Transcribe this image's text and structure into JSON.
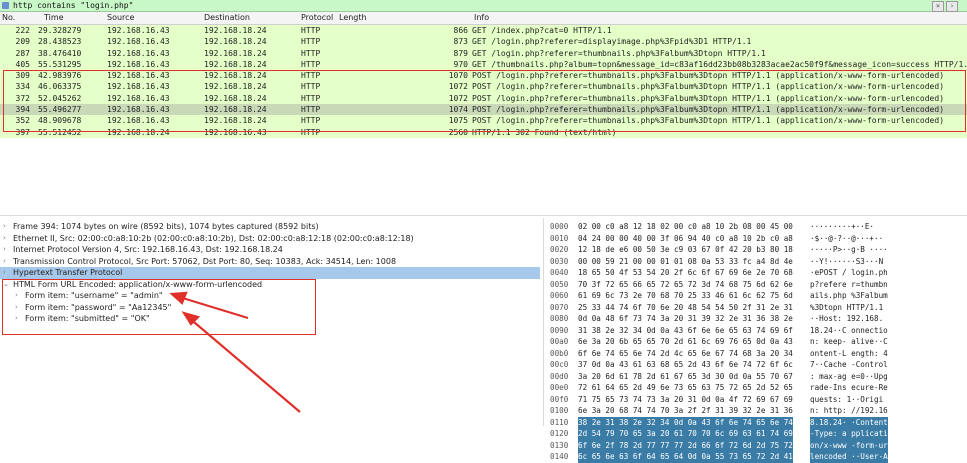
{
  "filter": {
    "value": "http contains \"login.php\""
  },
  "columns": {
    "no": "No.",
    "time": "Time",
    "source": "Source",
    "destination": "Destination",
    "protocol": "Protocol",
    "length": "Length",
    "info": "Info"
  },
  "packets": [
    {
      "no": "222",
      "time": "29.328279",
      "src": "192.168.16.43",
      "dst": "192.168.18.24",
      "proto": "HTTP",
      "len": "866",
      "info": "GET /index.php?cat=0 HTTP/1.1",
      "bg": "#e4ffc7"
    },
    {
      "no": "209",
      "time": "28.438523",
      "src": "192.168.16.43",
      "dst": "192.168.18.24",
      "proto": "HTTP",
      "len": "873",
      "info": "GET /login.php?referer=displayimage.php%3Fpid%3D1 HTTP/1.1",
      "bg": "#e4ffc7"
    },
    {
      "no": "287",
      "time": "38.476410",
      "src": "192.168.16.43",
      "dst": "192.168.18.24",
      "proto": "HTTP",
      "len": "879",
      "info": "GET /login.php?referer=thumbnails.php%3Falbum%3Dtopn HTTP/1.1",
      "bg": "#e4ffc7"
    },
    {
      "no": "405",
      "time": "55.531295",
      "src": "192.168.16.43",
      "dst": "192.168.18.24",
      "proto": "HTTP",
      "len": "970",
      "info": "GET /thumbnails.php?album=topn&message_id=c83af16dd23bb08b3283acae2ac50f9f&message_icon=success HTTP/1.1",
      "bg": "#e4ffc7"
    },
    {
      "no": "309",
      "time": "42.983976",
      "src": "192.168.16.43",
      "dst": "192.168.18.24",
      "proto": "HTTP",
      "len": "1070",
      "info": "POST /login.php?referer=thumbnails.php%3Falbum%3Dtopn HTTP/1.1  (application/x-www-form-urlencoded)",
      "bg": "#e4ffc7"
    },
    {
      "no": "334",
      "time": "46.063375",
      "src": "192.168.16.43",
      "dst": "192.168.18.24",
      "proto": "HTTP",
      "len": "1072",
      "info": "POST /login.php?referer=thumbnails.php%3Falbum%3Dtopn HTTP/1.1  (application/x-www-form-urlencoded)",
      "bg": "#e4ffc7"
    },
    {
      "no": "372",
      "time": "52.045262",
      "src": "192.168.16.43",
      "dst": "192.168.18.24",
      "proto": "HTTP",
      "len": "1072",
      "info": "POST /login.php?referer=thumbnails.php%3Falbum%3Dtopn HTTP/1.1  (application/x-www-form-urlencoded)",
      "bg": "#e4ffc7"
    },
    {
      "no": "394",
      "time": "55.496277",
      "src": "192.168.16.43",
      "dst": "192.168.18.24",
      "proto": "HTTP",
      "len": "1074",
      "info": "POST /login.php?referer=thumbnails.php%3Falbum%3Dtopn HTTP/1.1  (application/x-www-form-urlencoded)",
      "bg": "#c9d9b8"
    },
    {
      "no": "352",
      "time": "48.909678",
      "src": "192.168.16.43",
      "dst": "192.168.18.24",
      "proto": "HTTP",
      "len": "1075",
      "info": "POST /login.php?referer=thumbnails.php%3Falbum%3Dtopn HTTP/1.1  (application/x-www-form-urlencoded)",
      "bg": "#e4ffc7"
    },
    {
      "no": "397",
      "time": "55.512452",
      "src": "192.168.18.24",
      "dst": "192.168.16.43",
      "proto": "HTTP",
      "len": "2560",
      "info": "HTTP/1.1 302 Found  (text/html)",
      "bg": "#e4ffc7"
    }
  ],
  "details": [
    {
      "text": "Frame 394: 1074 bytes on wire (8592 bits), 1074 bytes captured (8592 bits)",
      "arrow": "›",
      "sub": false,
      "sel": false
    },
    {
      "text": "Ethernet II, Src: 02:00:c0:a8:10:2b (02:00:c0:a8:10:2b), Dst: 02:00:c0:a8:12:18 (02:00:c0:a8:12:18)",
      "arrow": "›",
      "sub": false,
      "sel": false
    },
    {
      "text": "Internet Protocol Version 4, Src: 192.168.16.43, Dst: 192.168.18.24",
      "arrow": "›",
      "sub": false,
      "sel": false
    },
    {
      "text": "Transmission Control Protocol, Src Port: 57062, Dst Port: 80, Seq: 10383, Ack: 34514, Len: 1008",
      "arrow": "›",
      "sub": false,
      "sel": false
    },
    {
      "text": "Hypertext Transfer Protocol",
      "arrow": "›",
      "sub": false,
      "sel": true
    },
    {
      "text": "HTML Form URL Encoded: application/x-www-form-urlencoded",
      "arrow": "⌄",
      "sub": false,
      "sel": false
    },
    {
      "text": "Form item: \"username\" = \"admin\"",
      "arrow": "›",
      "sub": true,
      "sel": false
    },
    {
      "text": "Form item: \"password\" = \"Aa12345\"",
      "arrow": "›",
      "sub": true,
      "sel": false
    },
    {
      "text": "Form item: \"submitted\" = \"OK\"",
      "arrow": "›",
      "sub": true,
      "sel": false
    }
  ],
  "hexdump": [
    {
      "off": "0000",
      "bytes": "02 00 c0 a8 12 18 02 00  c0 a8 10 2b 08 00 45 00",
      "asc": "·········+··E·"
    },
    {
      "off": "0010",
      "bytes": "04 24 00 00 40 00 3f 06  94 40 c0 a8 10 2b c0 a8",
      "asc": "·$··@·?··@···+··"
    },
    {
      "off": "0020",
      "bytes": "12 18 de e6 00 50 3e c9  03 67 0f 42 20 b3 80 18",
      "asc": "·····P>··g·B ····"
    },
    {
      "off": "0030",
      "bytes": "00 00 59 21 00 00 01 01  08 0a 53 33 fc a4 8d 4e",
      "asc": "··Y!······S3···N"
    },
    {
      "off": "0040",
      "bytes": "18 65 50 4f 53 54 20 2f  6c 6f 67 69 6e 2e 70 68",
      "asc": "·ePOST / login.ph"
    },
    {
      "off": "0050",
      "bytes": "70 3f 72 65 66 65 72 65  72 3d 74 68 75 6d 62 6e",
      "asc": "p?refere r=thumbn"
    },
    {
      "off": "0060",
      "bytes": "61 69 6c 73 2e 70 68 70  25 33 46 61 6c 62 75 6d",
      "asc": "ails.php %3Falbum"
    },
    {
      "off": "0070",
      "bytes": "25 33 44 74 6f 70 6e 20  48 54 54 50 2f 31 2e 31",
      "asc": "%3Dtopn  HTTP/1.1"
    },
    {
      "off": "0080",
      "bytes": "0d 0a 48 6f 73 74 3a 20  31 39 32 2e 31 36 38 2e",
      "asc": "··Host:  192.168."
    },
    {
      "off": "0090",
      "bytes": "31 38 2e 32 34 0d 0a 43  6f 6e 6e 65 63 74 69 6f",
      "asc": "18.24··C onnectio"
    },
    {
      "off": "00a0",
      "bytes": "6e 3a 20 6b 65 65 70 2d  61 6c 69 76 65 0d 0a 43",
      "asc": "n: keep- alive··C"
    },
    {
      "off": "00b0",
      "bytes": "6f 6e 74 65 6e 74 2d 4c  65 6e 67 74 68 3a 20 34",
      "asc": "ontent-L ength: 4"
    },
    {
      "off": "00c0",
      "bytes": "37 0d 0a 43 61 63 68 65  2d 43 6f 6e 74 72 6f 6c",
      "asc": "7··Cache -Control"
    },
    {
      "off": "00d0",
      "bytes": "3a 20 6d 61 78 2d 61 67  65 3d 30 0d 0a 55 70 67",
      "asc": ": max-ag e=0··Upg"
    },
    {
      "off": "00e0",
      "bytes": "72 61 64 65 2d 49 6e 73  65 63 75 72 65 2d 52 65",
      "asc": "rade-Ins ecure-Re"
    },
    {
      "off": "00f0",
      "bytes": "71 75 65 73 74 73 3a 20  31 0d 0a 4f 72 69 67 69",
      "asc": "quests:  1··Origi"
    },
    {
      "off": "0100",
      "bytes": "6e 3a 20 68 74 74 70 3a  2f 2f 31 39 32 2e 31 36",
      "asc": "n: http: //192.16"
    },
    {
      "off": "0110",
      "bytes": "38 2e 31 38 2e 32 34 0d  0a 43 6f 6e 74 65 6e 74",
      "asc": "8.18.24· ·Content"
    },
    {
      "off": "0120",
      "bytes": "2d 54 79 70 65 3a 20 61  70 70 6c 69 63 61 74 69",
      "asc": "-Type: a pplicati"
    },
    {
      "off": "0130",
      "bytes": "6f 6e 2f 78 2d 77 77 77  2d 66 6f 72 6d 2d 75 72",
      "asc": "on/x-www -form-ur"
    },
    {
      "off": "0140",
      "bytes": "6c 65 6e 63 6f 64 65 64  0d 0a 55 73 65 72 2d 41",
      "asc": "lencoded ··User-A"
    }
  ],
  "colors": {
    "accent_red": "#e0302a",
    "selected_blue": "#a6c8ea",
    "row_green": "#e4ffc7",
    "filter_green": "#c8f7c8",
    "hex_highlight": "#3a7ca5"
  }
}
